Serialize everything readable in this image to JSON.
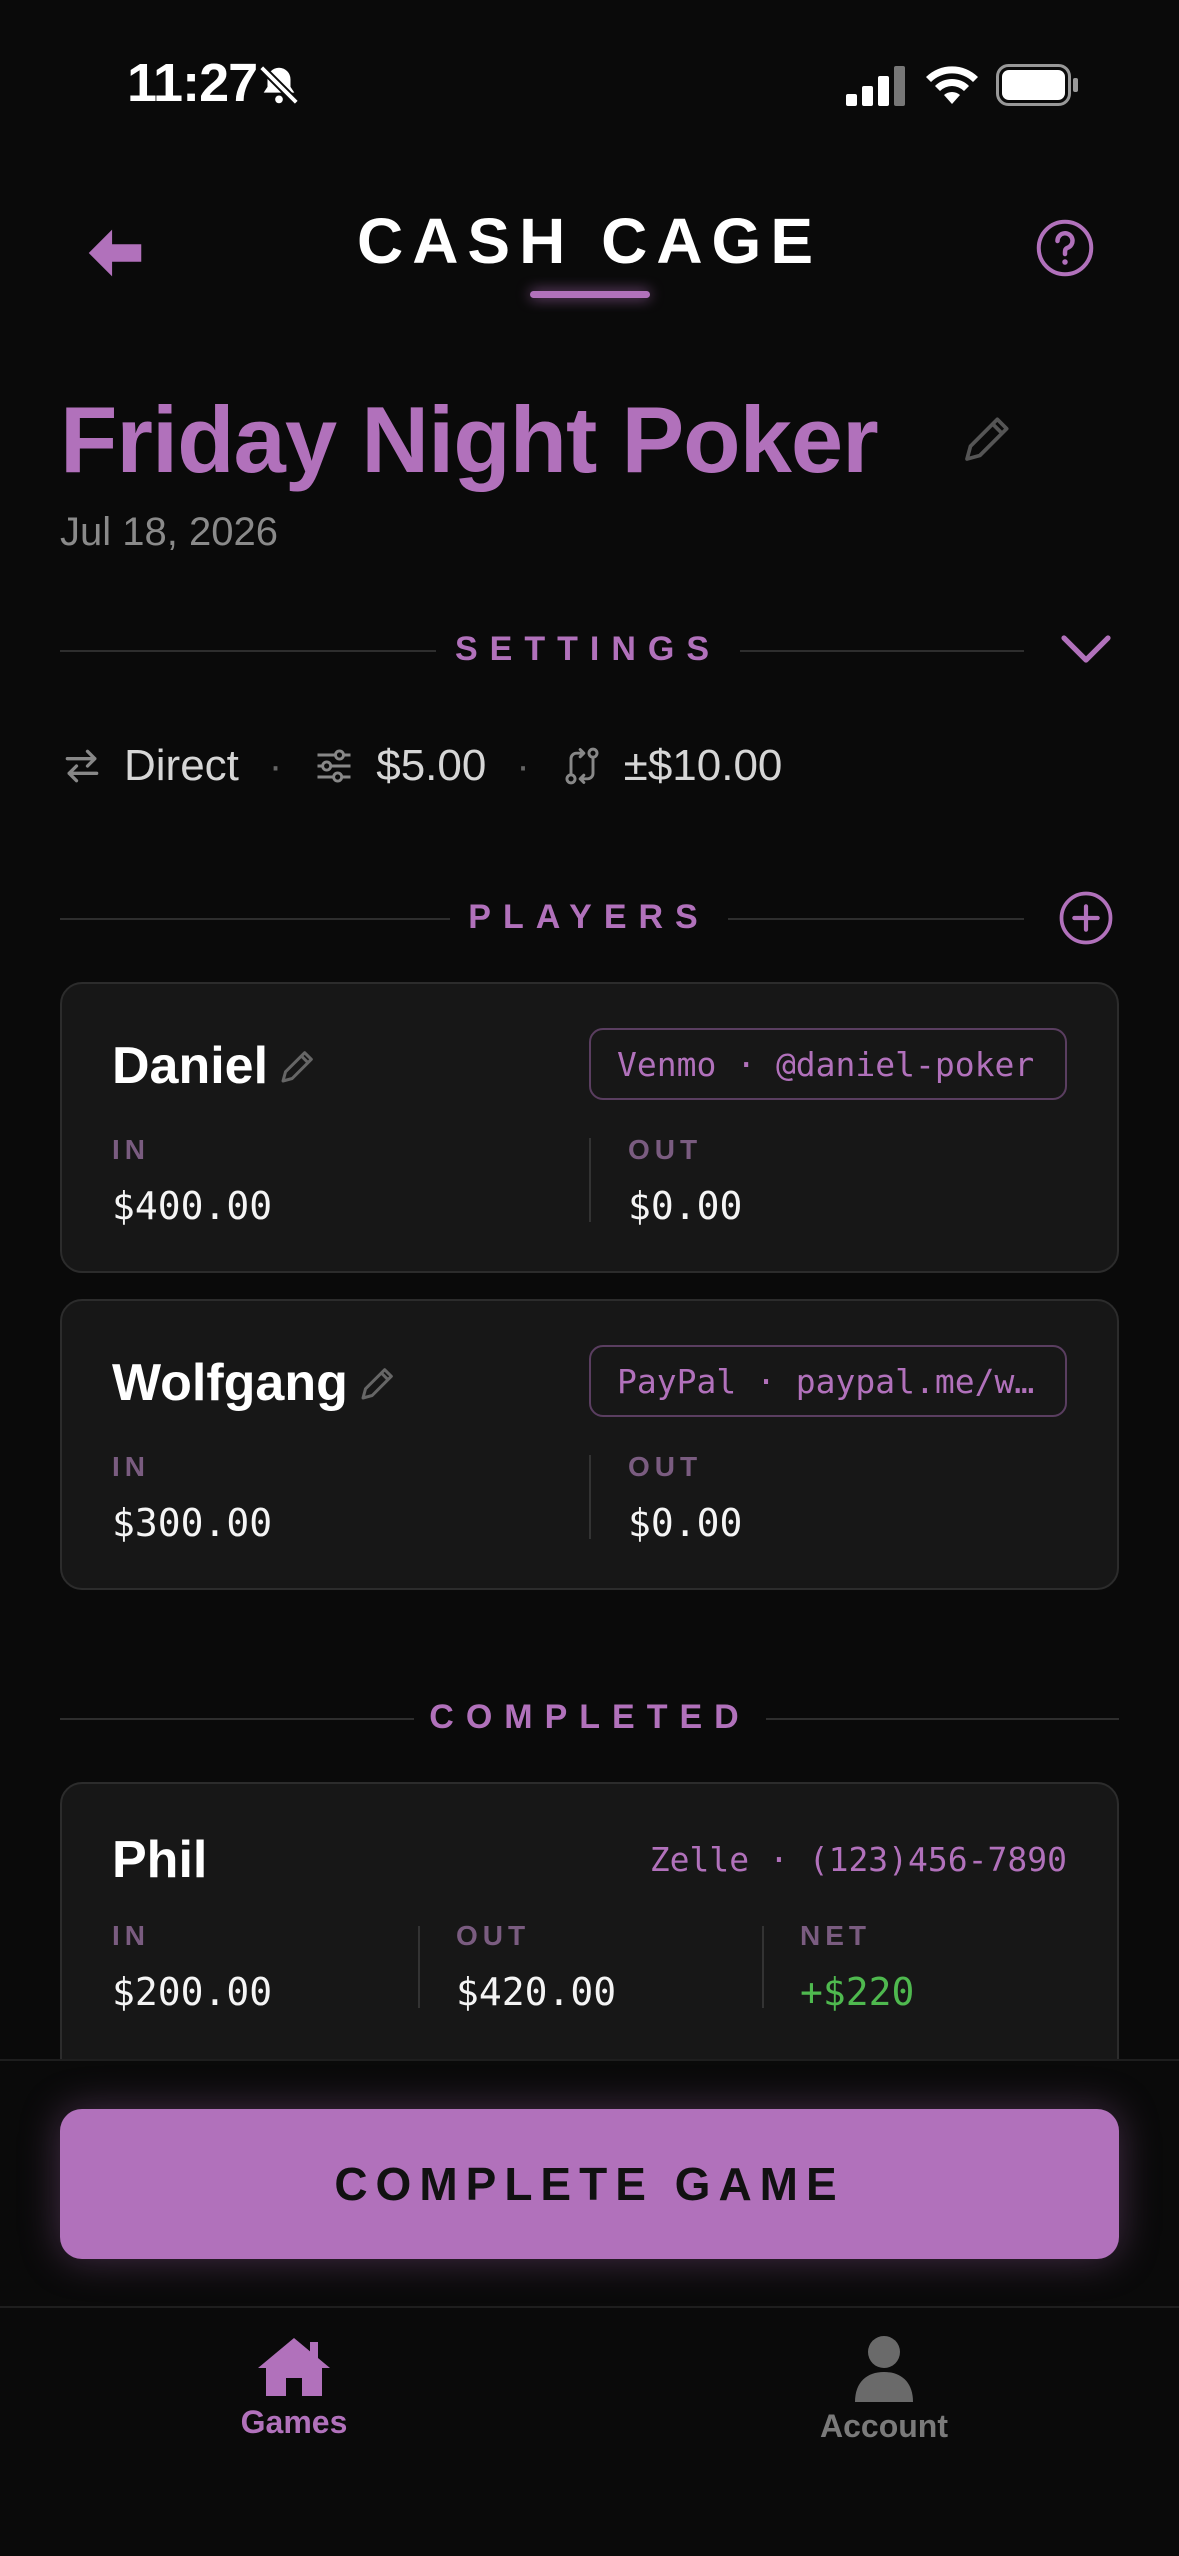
{
  "status_bar": {
    "time": "11:27"
  },
  "header": {
    "title": "CASH CAGE"
  },
  "game": {
    "name": "Friday Night Poker",
    "date": "Jul 18, 2026"
  },
  "settings": {
    "section_label": "SETTINGS",
    "mode": "Direct",
    "amount": "$5.00",
    "tolerance": "±$10.00"
  },
  "players_section": {
    "label": "PLAYERS",
    "in_label": "IN",
    "out_label": "OUT",
    "items": [
      {
        "name": "Daniel",
        "payment": "Venmo · @daniel-poker",
        "in": "$400.00",
        "out": "$0.00"
      },
      {
        "name": "Wolfgang",
        "payment": "PayPal · paypal.me/w…",
        "in": "$300.00",
        "out": "$0.00"
      }
    ]
  },
  "completed_section": {
    "label": "COMPLETED",
    "in_label": "IN",
    "out_label": "OUT",
    "net_label": "NET",
    "items": [
      {
        "name": "Phil",
        "payment": "Zelle · (123)456-7890",
        "in": "$200.00",
        "out": "$420.00",
        "net": "+$220"
      }
    ]
  },
  "actions": {
    "complete_label": "COMPLETE GAME"
  },
  "tabs": [
    {
      "label": "Games",
      "icon": "home-icon",
      "active": true
    },
    {
      "label": "Account",
      "icon": "person-icon",
      "active": false
    }
  ],
  "colors": {
    "accent": "#b171bb",
    "background": "#0a0a0a",
    "card": "#171717",
    "positive": "#4fb94f"
  }
}
